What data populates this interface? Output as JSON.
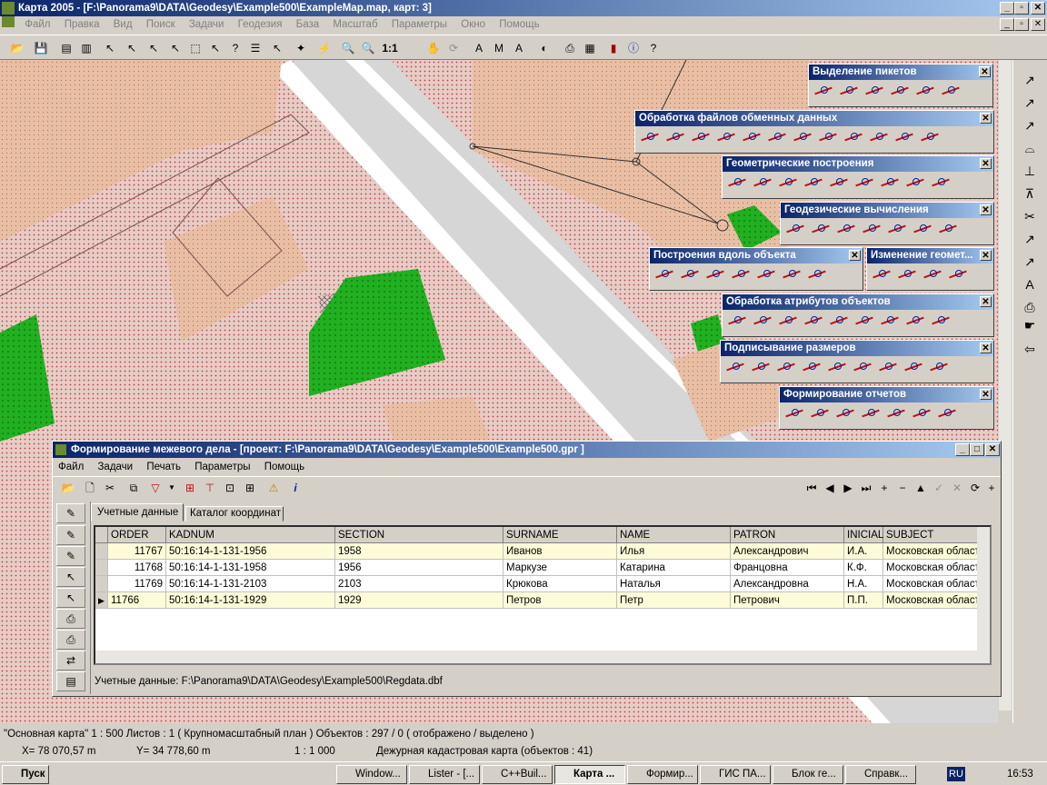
{
  "app": {
    "title": "Карта 2005 - [F:\\Panorama9\\DATA\\Geodesy\\Example500\\ExampleMap.map, карт: 3]"
  },
  "menu": [
    "Файл",
    "Правка",
    "Вид",
    "Поиск",
    "Задачи",
    "Геодезия",
    "База",
    "Масштаб",
    "Параметры",
    "Окно",
    "Помощь"
  ],
  "toolbar_scale": "1:1",
  "panels": {
    "p1": "Выделение пикетов",
    "p2": "Обработка файлов обменных данных",
    "p3": "Геометрические построения",
    "p4": "Геодезические вычисления",
    "p5": "Построения вдоль объекта",
    "p6": "Изменение геомет...",
    "p7": "Обработка атрибутов объектов",
    "p8": "Подписывание размеров",
    "p9": "Формирование отчетов"
  },
  "window": {
    "title": "Формирование межевого дела - [проект: F:\\Panorama9\\DATA\\Geodesy\\Example500\\Example500.gpr ]",
    "menu": [
      "Файл",
      "Задачи",
      "Печать",
      "Параметры",
      "Помощь"
    ],
    "tabs": [
      "Учетные данные",
      "Каталог координат"
    ],
    "columns": [
      "ORDER",
      "KADNUM",
      "SECTION",
      "SURNAME",
      "NAME",
      "PATRON",
      "INICIAL",
      "SUBJECT"
    ],
    "rows": [
      [
        "11767",
        "50:16:14-1-131-1956",
        "1958",
        "Иванов",
        "Илья",
        "Александрович",
        "И.А.",
        "Московская област"
      ],
      [
        "11768",
        "50:16:14-1-131-1958",
        "1956",
        "Маркузе",
        "Катарина",
        "Францовна",
        "К.Ф.",
        "Московская област"
      ],
      [
        "11769",
        "50:16:14-1-131-2103",
        "2103",
        "Крюкова",
        "Наталья",
        "Александровна",
        "Н.А.",
        "Московская област"
      ],
      [
        "11766",
        "50:16:14-1-131-1929",
        "1929",
        "Петров",
        "Петр",
        "Петрович",
        "П.П.",
        "Московская област"
      ]
    ],
    "footer": "Учетные данные: F:\\Panorama9\\DATA\\Geodesy\\Example500\\Regdata.dbf"
  },
  "status": {
    "line1": "\"Основная карта\"   1 : 500   Листов : 1   ( Крупномасштабный план )     Объектов : 297 / 0  ( отображено / выделено )",
    "x": "X=  78 070,57 m",
    "y": "Y=   34 778,60 m",
    "scale": "1 : 1 000",
    "map": "Дежурная кадастровая карта  (объектов : 41)"
  },
  "taskbar": {
    "start": "Пуск",
    "tasks": [
      "Window...",
      "Lister - [...",
      "C++Buil...",
      "Карта ...",
      "Формир...",
      "ГИС ПА...",
      "Блок ге...",
      "Справк..."
    ],
    "lang": "RU",
    "time": "16:53"
  }
}
